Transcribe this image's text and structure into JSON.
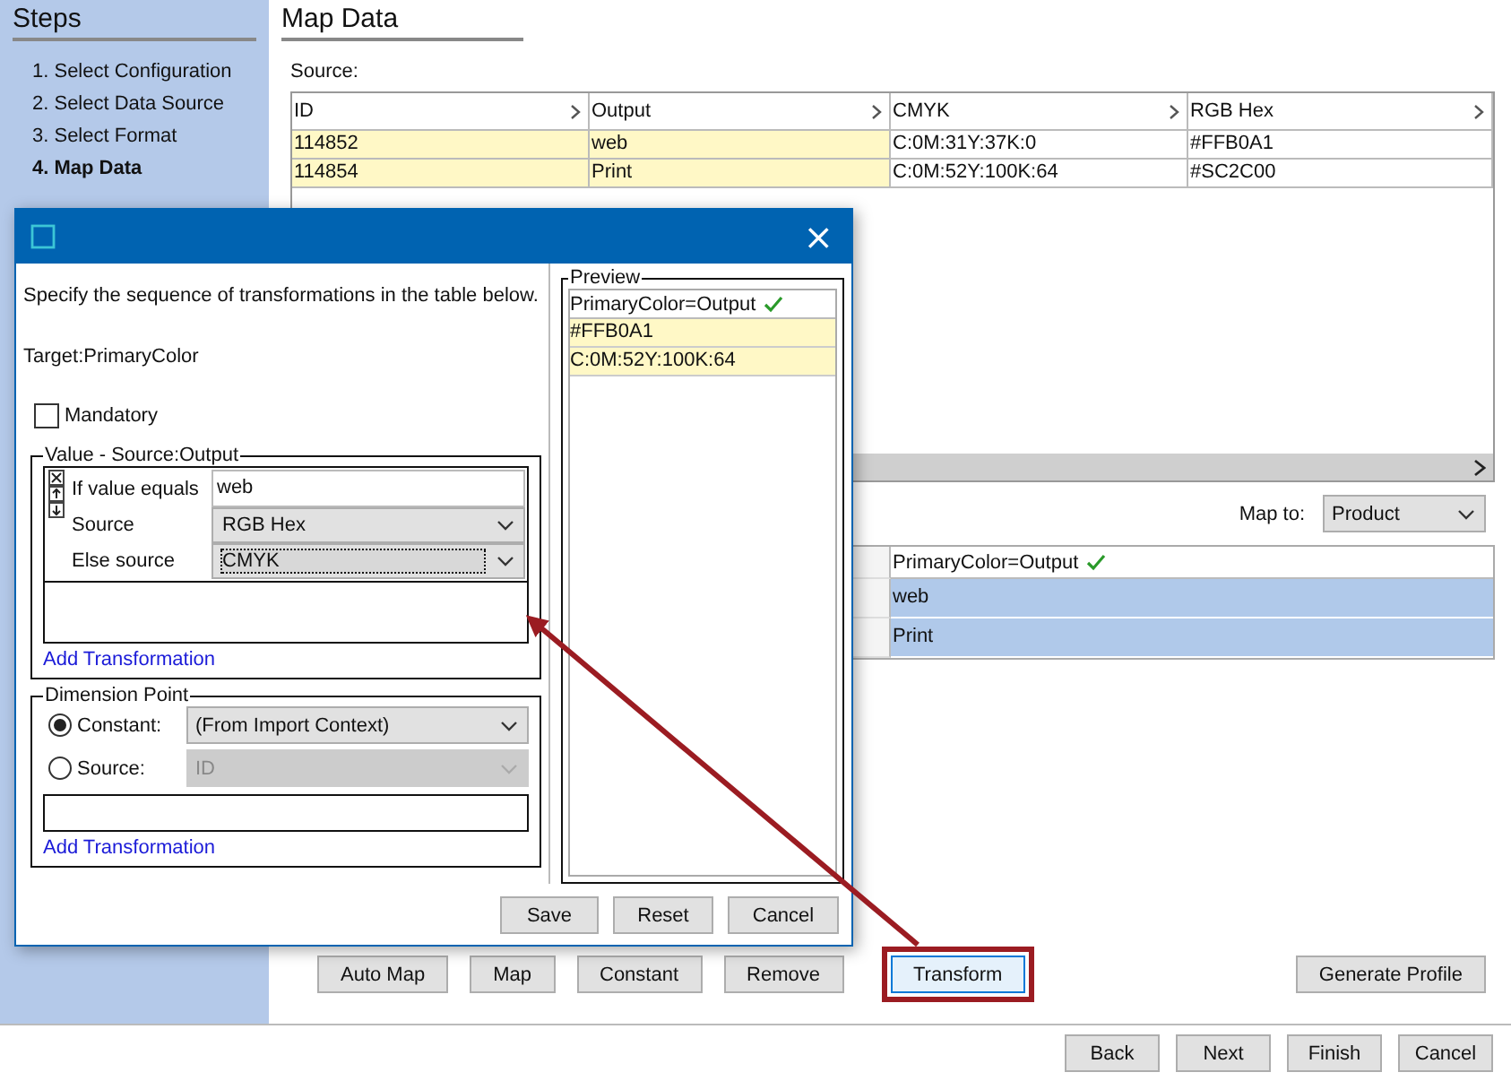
{
  "sidebar": {
    "title": "Steps",
    "steps": [
      {
        "label": "1. Select Configuration",
        "selected": false
      },
      {
        "label": "2. Select Data Source",
        "selected": false
      },
      {
        "label": "3. Select Format",
        "selected": false
      },
      {
        "label": "4. Map Data",
        "selected": true
      }
    ]
  },
  "page": {
    "title": "Map Data"
  },
  "source": {
    "label": "Source:",
    "columns": [
      {
        "label": "ID",
        "mapped": true
      },
      {
        "label": "Output",
        "mapped": true
      },
      {
        "label": "CMYK",
        "mapped": false
      },
      {
        "label": "RGB Hex",
        "mapped": false
      }
    ],
    "rows": [
      [
        "114852",
        "web",
        "C:0M:31Y:37K:0",
        "#FFB0A1"
      ],
      [
        "114854",
        "Print",
        "C:0M:52Y:100K:64",
        "#SC2C00"
      ]
    ]
  },
  "map_to": {
    "label": "Map to:",
    "value": "Product"
  },
  "target": {
    "column": "PrimaryColor=Output",
    "valid": true,
    "rows": [
      {
        "value": "web",
        "selected": true
      },
      {
        "value": "Print",
        "selected": true
      }
    ]
  },
  "actions": [
    {
      "label": "Auto Map",
      "highlighted": false
    },
    {
      "label": "Map",
      "highlighted": false
    },
    {
      "label": "Constant",
      "highlighted": false
    },
    {
      "label": "Remove",
      "highlighted": false
    },
    {
      "label": "Transform",
      "highlighted": true
    }
  ],
  "profile_button": "Generate Profile",
  "nav": [
    "Back",
    "Next",
    "Finish",
    "Cancel"
  ],
  "dialog": {
    "close": "×",
    "instruction": "Specify the sequence of transformations in the table below.",
    "target": "Target:PrimaryColor",
    "mandatory": {
      "label": "Mandatory",
      "checked": false
    },
    "value_group": {
      "title": "Value - Source:Output",
      "rules": [
        {
          "label": "If value equals",
          "kind": "text",
          "value": "web"
        },
        {
          "label": "Source",
          "kind": "select",
          "value": "RGB Hex",
          "focused": false
        },
        {
          "label": "Else source",
          "kind": "select",
          "value": "CMYK",
          "focused": true
        }
      ],
      "add_link": "Add Transformation"
    },
    "dimension": {
      "title": "Dimension Point",
      "options": [
        {
          "label": "Constant:",
          "selected": true,
          "value": "(From Import Context)"
        },
        {
          "label": "Source:",
          "selected": false,
          "value": "ID"
        }
      ],
      "add_link": "Add Transformation"
    },
    "preview": {
      "title": "Preview",
      "column": "PrimaryColor=Output",
      "valid": true,
      "rows": [
        "#FFB0A1",
        "C:0M:52Y:100K:64"
      ]
    },
    "buttons": [
      "Save",
      "Reset",
      "Cancel"
    ]
  }
}
